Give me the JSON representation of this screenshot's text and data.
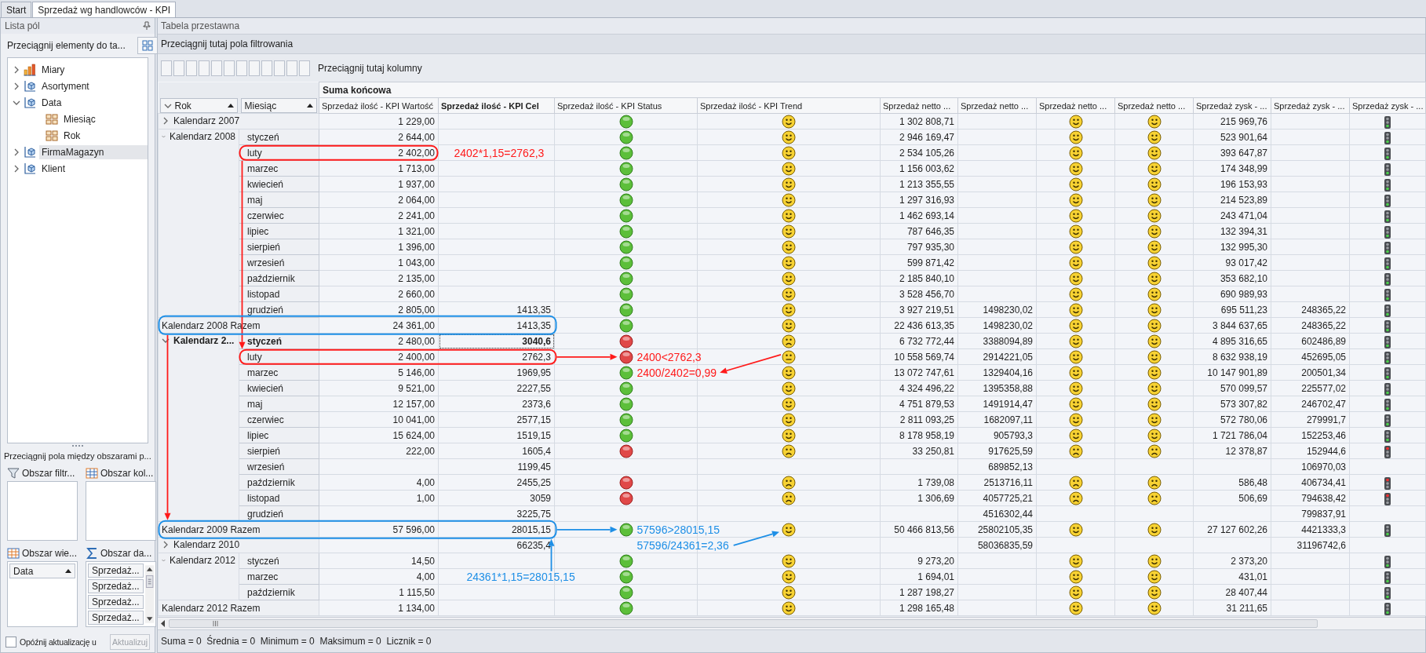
{
  "tabs": [
    {
      "label": "Start",
      "selected": false
    },
    {
      "label": "Sprzedaż wg handlowców - KPI",
      "selected": true
    }
  ],
  "field_list": {
    "title": "Lista pól",
    "drag_hint": "Przeciągnij elementy do ta...",
    "tree": [
      {
        "label": "Miary",
        "kind": "measures",
        "expanded": false,
        "selected": false
      },
      {
        "label": "Asortyment",
        "kind": "dimension",
        "expanded": false,
        "selected": false
      },
      {
        "label": "Data",
        "kind": "dimension",
        "expanded": true,
        "selected": false,
        "children": [
          {
            "label": "Miesiąc",
            "kind": "hierarchy",
            "selected": false
          },
          {
            "label": "Rok",
            "kind": "hierarchy",
            "selected": false
          }
        ]
      },
      {
        "label": "FirmaMagazyn",
        "kind": "dimension",
        "expanded": false,
        "selected": true
      },
      {
        "label": "Klient",
        "kind": "dimension",
        "expanded": false,
        "selected": false
      }
    ],
    "areas_hint": "Przeciągnij pola między obszarami p...",
    "areas": [
      {
        "label": "Obszar filtr...",
        "kind": "filter"
      },
      {
        "label": "Obszar kol...",
        "kind": "columns"
      },
      {
        "label": "Obszar wie...",
        "kind": "rows",
        "items": [
          {
            "label": "Data",
            "sort_ascending": true
          }
        ]
      },
      {
        "label": "Obszar da...",
        "kind": "data",
        "items": [
          {
            "label": "Sprzedaż..."
          },
          {
            "label": "Sprzedaż..."
          },
          {
            "label": "Sprzedaż..."
          },
          {
            "label": "Sprzedaż..."
          }
        ]
      }
    ],
    "delay_update": {
      "label": "Opóźnij aktualizację u",
      "checked": false
    },
    "update_button": {
      "label": "Aktualizuj",
      "disabled": true
    }
  },
  "pivot": {
    "title": "Tabela przestawna",
    "filter_hint": "Przeciągnij tutaj pola filtrowania",
    "column_hint": "Przeciągnij tutaj kolumny",
    "row_fields": [
      {
        "label": "Rok",
        "expanded": true,
        "sort_ascending": true
      },
      {
        "label": "Miesiąc",
        "sort_ascending": true
      }
    ],
    "grand_total_label": "Suma końcowa",
    "columns": [
      {
        "label": "Sprzedaż ilość - KPI Wartość",
        "kind": "number",
        "selected": false
      },
      {
        "label": "Sprzedaż ilość - KPI Cel",
        "kind": "number",
        "selected": true
      },
      {
        "label": "Sprzedaż ilość - KPI Status",
        "kind": "ball",
        "selected": false
      },
      {
        "label": "Sprzedaż ilość - KPI Trend",
        "kind": "smiley",
        "selected": false
      },
      {
        "label": "Sprzedaż netto ...",
        "kind": "number",
        "selected": false
      },
      {
        "label": "Sprzedaż netto ...",
        "kind": "number",
        "selected": false
      },
      {
        "label": "Sprzedaż netto ...",
        "kind": "smiley",
        "selected": false
      },
      {
        "label": "Sprzedaż netto ...",
        "kind": "smiley",
        "selected": false
      },
      {
        "label": "Sprzedaż zysk - ...",
        "kind": "number",
        "selected": false
      },
      {
        "label": "Sprzedaż zysk - ...",
        "kind": "number",
        "selected": false
      },
      {
        "label": "Sprzedaż zysk - ...",
        "kind": "light",
        "selected": false
      }
    ],
    "rows": [
      {
        "kind": "year",
        "label": "Kalendarz 2007",
        "expanded": false,
        "selected": false,
        "cells": [
          "1 229,00",
          null,
          {
            "kind": "good"
          },
          {
            "kind": "good"
          },
          "1 302 808,71",
          null,
          {
            "kind": "good"
          },
          {
            "kind": "good"
          },
          "215 969,76",
          null,
          {
            "kind": "good"
          }
        ]
      },
      {
        "kind": "year",
        "label": "Kalendarz 2008",
        "expanded": true,
        "selected": false,
        "months": [
          {
            "month": "styczeń",
            "selected": false,
            "cells": [
              "2 644,00",
              null,
              {
                "kind": "good"
              },
              {
                "kind": "good"
              },
              "2 946 169,47",
              null,
              {
                "kind": "good"
              },
              {
                "kind": "good"
              },
              "523 901,64",
              null,
              {
                "kind": "good"
              }
            ]
          },
          {
            "month": "luty",
            "selected": false,
            "cells": [
              "2 402,00",
              null,
              {
                "kind": "good"
              },
              {
                "kind": "good"
              },
              "2 534 105,26",
              null,
              {
                "kind": "good"
              },
              {
                "kind": "good"
              },
              "393 647,87",
              null,
              {
                "kind": "good"
              }
            ]
          },
          {
            "month": "marzec",
            "selected": false,
            "cells": [
              "1 713,00",
              null,
              {
                "kind": "good"
              },
              {
                "kind": "good"
              },
              "1 156 003,62",
              null,
              {
                "kind": "good"
              },
              {
                "kind": "good"
              },
              "174 348,99",
              null,
              {
                "kind": "good"
              }
            ]
          },
          {
            "month": "kwiecień",
            "selected": false,
            "cells": [
              "1 937,00",
              null,
              {
                "kind": "good"
              },
              {
                "kind": "good"
              },
              "1 213 355,55",
              null,
              {
                "kind": "good"
              },
              {
                "kind": "good"
              },
              "196 153,93",
              null,
              {
                "kind": "good"
              }
            ]
          },
          {
            "month": "maj",
            "selected": false,
            "cells": [
              "2 064,00",
              null,
              {
                "kind": "good"
              },
              {
                "kind": "good"
              },
              "1 297 316,93",
              null,
              {
                "kind": "good"
              },
              {
                "kind": "good"
              },
              "214 523,89",
              null,
              {
                "kind": "good"
              }
            ]
          },
          {
            "month": "czerwiec",
            "selected": false,
            "cells": [
              "2 241,00",
              null,
              {
                "kind": "good"
              },
              {
                "kind": "good"
              },
              "1 462 693,14",
              null,
              {
                "kind": "good"
              },
              {
                "kind": "good"
              },
              "243 471,04",
              null,
              {
                "kind": "good"
              }
            ]
          },
          {
            "month": "lipiec",
            "selected": false,
            "cells": [
              "1 321,00",
              null,
              {
                "kind": "good"
              },
              {
                "kind": "good"
              },
              "787 646,35",
              null,
              {
                "kind": "good"
              },
              {
                "kind": "good"
              },
              "132 394,31",
              null,
              {
                "kind": "good"
              }
            ]
          },
          {
            "month": "sierpień",
            "selected": false,
            "cells": [
              "1 396,00",
              null,
              {
                "kind": "good"
              },
              {
                "kind": "good"
              },
              "797 935,30",
              null,
              {
                "kind": "good"
              },
              {
                "kind": "good"
              },
              "132 995,30",
              null,
              {
                "kind": "good"
              }
            ]
          },
          {
            "month": "wrzesień",
            "selected": false,
            "cells": [
              "1 043,00",
              null,
              {
                "kind": "good"
              },
              {
                "kind": "good"
              },
              "599 871,42",
              null,
              {
                "kind": "good"
              },
              {
                "kind": "good"
              },
              "93 017,42",
              null,
              {
                "kind": "good"
              }
            ]
          },
          {
            "month": "październik",
            "selected": false,
            "cells": [
              "2 135,00",
              null,
              {
                "kind": "good"
              },
              {
                "kind": "good"
              },
              "2 185 840,10",
              null,
              {
                "kind": "good"
              },
              {
                "kind": "good"
              },
              "353 682,10",
              null,
              {
                "kind": "good"
              }
            ]
          },
          {
            "month": "listopad",
            "selected": false,
            "cells": [
              "2 660,00",
              null,
              {
                "kind": "good"
              },
              {
                "kind": "good"
              },
              "3 528 456,70",
              null,
              {
                "kind": "good"
              },
              {
                "kind": "good"
              },
              "690 989,93",
              null,
              {
                "kind": "good"
              }
            ]
          },
          {
            "month": "grudzień",
            "selected": false,
            "cells": [
              "2 805,00",
              "1413,35",
              {
                "kind": "good"
              },
              {
                "kind": "good"
              },
              "3 927 219,51",
              "1498230,02",
              {
                "kind": "good"
              },
              {
                "kind": "good"
              },
              "695 511,23",
              "248365,22",
              {
                "kind": "good"
              }
            ]
          }
        ]
      },
      {
        "kind": "total",
        "label": "Kalendarz 2008 Razem",
        "selected": false,
        "cells": [
          "24 361,00",
          "1413,35",
          {
            "kind": "good"
          },
          {
            "kind": "good"
          },
          "22 436 613,35",
          "1498230,02",
          {
            "kind": "good"
          },
          {
            "kind": "good"
          },
          "3 844 637,65",
          "248365,22",
          {
            "kind": "good"
          }
        ]
      },
      {
        "kind": "year",
        "label": "Kalendarz 2...",
        "expanded": true,
        "selected": true,
        "months": [
          {
            "month": "styczeń",
            "selected": true,
            "cells": [
              "2 480,00",
              "3040,6",
              {
                "kind": "bad"
              },
              {
                "kind": "bad"
              },
              "6 732 772,44",
              "3388094,89",
              {
                "kind": "good"
              },
              {
                "kind": "good"
              },
              "4 895 316,65",
              "602486,89",
              {
                "kind": "good"
              }
            ]
          },
          {
            "month": "luty",
            "selected": false,
            "cells": [
              "2 400,00",
              "2762,3",
              {
                "kind": "bad"
              },
              {
                "kind": "neutral"
              },
              "10 558 569,74",
              "2914221,05",
              {
                "kind": "good"
              },
              {
                "kind": "good"
              },
              "8 632 938,19",
              "452695,05",
              {
                "kind": "good"
              }
            ]
          },
          {
            "month": "marzec",
            "selected": false,
            "cells": [
              "5 146,00",
              "1969,95",
              {
                "kind": "good"
              },
              {
                "kind": "good"
              },
              "13 072 747,61",
              "1329404,16",
              {
                "kind": "good"
              },
              {
                "kind": "good"
              },
              "10 147 901,89",
              "200501,34",
              {
                "kind": "good"
              }
            ]
          },
          {
            "month": "kwiecień",
            "selected": false,
            "cells": [
              "9 521,00",
              "2227,55",
              {
                "kind": "good"
              },
              {
                "kind": "good"
              },
              "4 324 496,22",
              "1395358,88",
              {
                "kind": "good"
              },
              {
                "kind": "good"
              },
              "570 099,57",
              "225577,02",
              {
                "kind": "good"
              }
            ]
          },
          {
            "month": "maj",
            "selected": false,
            "cells": [
              "12 157,00",
              "2373,6",
              {
                "kind": "good"
              },
              {
                "kind": "good"
              },
              "4 751 879,53",
              "1491914,47",
              {
                "kind": "good"
              },
              {
                "kind": "good"
              },
              "573 307,82",
              "246702,47",
              {
                "kind": "good"
              }
            ]
          },
          {
            "month": "czerwiec",
            "selected": false,
            "cells": [
              "10 041,00",
              "2577,15",
              {
                "kind": "good"
              },
              {
                "kind": "good"
              },
              "2 811 093,25",
              "1682097,11",
              {
                "kind": "good"
              },
              {
                "kind": "good"
              },
              "572 780,06",
              "279991,7",
              {
                "kind": "good"
              }
            ]
          },
          {
            "month": "lipiec",
            "selected": false,
            "cells": [
              "15 624,00",
              "1519,15",
              {
                "kind": "good"
              },
              {
                "kind": "good"
              },
              "8 178 958,19",
              "905793,3",
              {
                "kind": "good"
              },
              {
                "kind": "good"
              },
              "1 721 786,04",
              "152253,46",
              {
                "kind": "good"
              }
            ]
          },
          {
            "month": "sierpień",
            "selected": false,
            "cells": [
              "222,00",
              "1605,4",
              {
                "kind": "bad"
              },
              {
                "kind": "bad"
              },
              "33 250,81",
              "917625,59",
              {
                "kind": "bad"
              },
              {
                "kind": "bad"
              },
              "12 378,87",
              "152944,6",
              {
                "kind": "bad"
              }
            ]
          },
          {
            "month": "wrzesień",
            "selected": false,
            "cells": [
              null,
              "1199,45",
              null,
              null,
              null,
              "689852,13",
              null,
              null,
              null,
              "106970,03",
              null
            ]
          },
          {
            "month": "październik",
            "selected": false,
            "cells": [
              "4,00",
              "2455,25",
              {
                "kind": "bad"
              },
              {
                "kind": "bad"
              },
              "1 739,08",
              "2513716,11",
              {
                "kind": "bad"
              },
              {
                "kind": "bad"
              },
              "586,48",
              "406734,41",
              {
                "kind": "bad"
              }
            ]
          },
          {
            "month": "listopad",
            "selected": false,
            "cells": [
              "1,00",
              "3059",
              {
                "kind": "bad"
              },
              {
                "kind": "bad"
              },
              "1 306,69",
              "4057725,21",
              {
                "kind": "bad"
              },
              {
                "kind": "bad"
              },
              "506,69",
              "794638,42",
              {
                "kind": "bad"
              }
            ]
          },
          {
            "month": "grudzień",
            "selected": false,
            "cells": [
              null,
              "3225,75",
              null,
              null,
              null,
              "4516302,44",
              null,
              null,
              null,
              "799837,91",
              null
            ]
          }
        ]
      },
      {
        "kind": "total",
        "label": "Kalendarz 2009 Razem",
        "selected": false,
        "cells": [
          "57 596,00",
          "28015,15",
          {
            "kind": "good"
          },
          {
            "kind": "good"
          },
          "50 466 813,56",
          "25802105,35",
          {
            "kind": "good"
          },
          {
            "kind": "good"
          },
          "27 127 602,26",
          "4421333,3",
          {
            "kind": "good"
          }
        ]
      },
      {
        "kind": "year",
        "label": "Kalendarz 2010",
        "expanded": false,
        "selected": false,
        "cells": [
          null,
          "66235,4",
          null,
          null,
          null,
          "58036835,59",
          null,
          null,
          null,
          "31196742,6",
          null
        ]
      },
      {
        "kind": "year",
        "label": "Kalendarz 2012",
        "expanded": true,
        "selected": false,
        "months": [
          {
            "month": "styczeń",
            "selected": false,
            "cells": [
              "14,50",
              null,
              {
                "kind": "good"
              },
              {
                "kind": "good"
              },
              "9 273,20",
              null,
              {
                "kind": "good"
              },
              {
                "kind": "good"
              },
              "2 373,20",
              null,
              {
                "kind": "good"
              }
            ]
          },
          {
            "month": "marzec",
            "selected": false,
            "cells": [
              "4,00",
              null,
              {
                "kind": "good"
              },
              {
                "kind": "good"
              },
              "1 694,01",
              null,
              {
                "kind": "good"
              },
              {
                "kind": "good"
              },
              "431,01",
              null,
              {
                "kind": "good"
              }
            ]
          },
          {
            "month": "październik",
            "selected": false,
            "cells": [
              "1 115,50",
              null,
              {
                "kind": "good"
              },
              {
                "kind": "good"
              },
              "1 287 198,27",
              null,
              {
                "kind": "good"
              },
              {
                "kind": "good"
              },
              "28 407,44",
              null,
              {
                "kind": "good"
              }
            ]
          }
        ]
      },
      {
        "kind": "total",
        "label": "Kalendarz 2012 Razem",
        "selected": false,
        "cells": [
          "1 134,00",
          null,
          {
            "kind": "good"
          },
          {
            "kind": "good"
          },
          "1 298 165,48",
          null,
          {
            "kind": "good"
          },
          {
            "kind": "good"
          },
          "31 211,65",
          null,
          {
            "kind": "good"
          }
        ]
      }
    ],
    "annotations": [
      {
        "text": "2402*1,15=2762,3",
        "color": "#ff1a1a"
      },
      {
        "text": "2400<2762,3",
        "color": "#ff1a1a"
      },
      {
        "text": "2400/2402=0,99",
        "color": "#ff1a1a"
      },
      {
        "text": "57596>28015,15",
        "color": "#1e8fe6"
      },
      {
        "text": "57596/24361=2,36",
        "color": "#1e8fe6"
      },
      {
        "text": "24361*1,15=28015,15",
        "color": "#1e8fe6"
      }
    ]
  },
  "status_bar": {
    "text": "Suma = 0  Średnia = 0  Minimum = 0  Maksimum = 0  Licznik = 0"
  }
}
